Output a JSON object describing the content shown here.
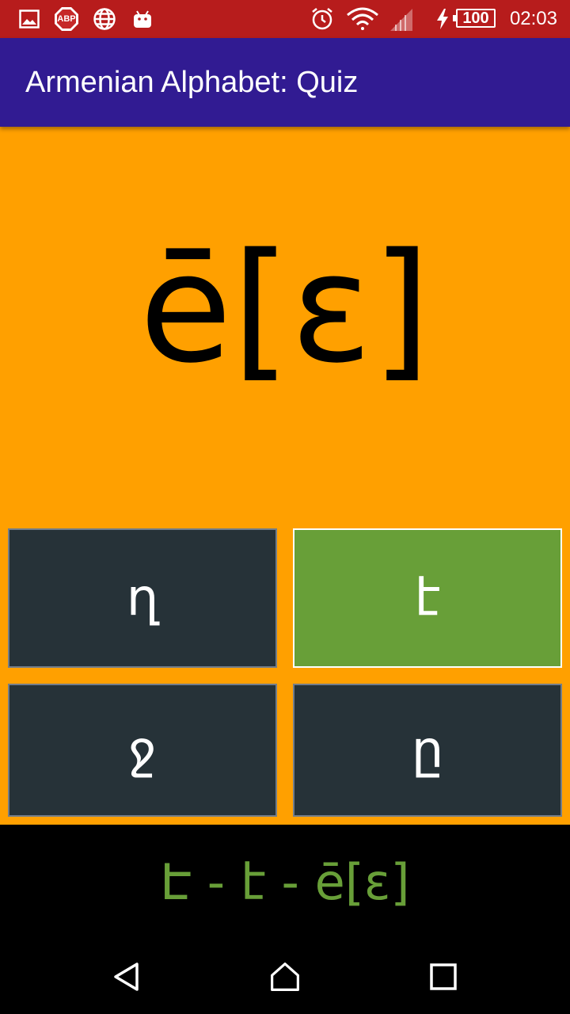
{
  "status_bar": {
    "adblock_label": "ABP",
    "battery": "100",
    "time": "02:03"
  },
  "icons": {
    "status_left": [
      "image-icon",
      "adblock-icon",
      "globe-icon",
      "android-icon"
    ],
    "status_right": [
      "alarm-icon",
      "wifi-icon",
      "signal-icon",
      "charging-icon",
      "battery-icon"
    ],
    "nav": [
      "back-icon",
      "home-icon",
      "recents-icon"
    ]
  },
  "app_bar": {
    "title": "Armenian Alphabet: Quiz"
  },
  "question": {
    "text": "ē[ɛ]"
  },
  "answers": [
    {
      "label": "ղ",
      "state": "default"
    },
    {
      "label": "է",
      "state": "correct"
    },
    {
      "label": "ջ",
      "state": "default"
    },
    {
      "label": "ը",
      "state": "default"
    }
  ],
  "result": {
    "text": "Է - է - ē[ɛ]"
  },
  "colors": {
    "status_bar": "#b71c1c",
    "app_bar": "#311b92",
    "background": "#ffa000",
    "button": "#263238",
    "correct": "#689f38",
    "result_text": "#689f38"
  }
}
